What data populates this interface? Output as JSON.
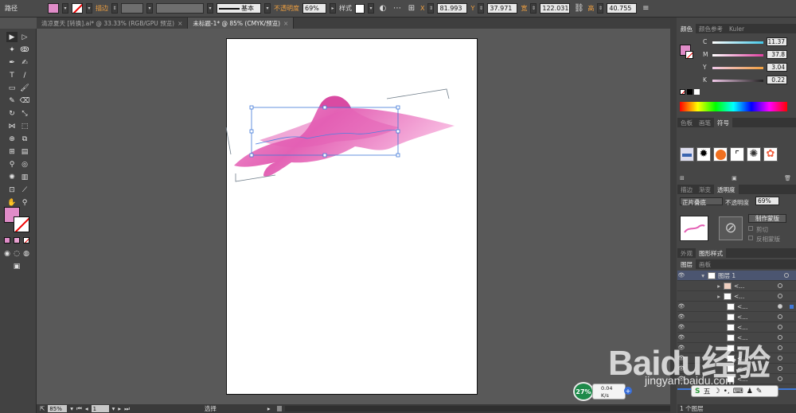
{
  "control_bar": {
    "object_type": "路径",
    "stroke_label": "描边",
    "stroke_profile": "基本",
    "opacity_label": "不透明度",
    "opacity_value": "69%",
    "style_label": "样式",
    "x_label": "X",
    "x_value": "81.993",
    "y_label": "Y",
    "y_value": "37.971",
    "w_label": "宽",
    "w_value": "122.031",
    "h_label": "高",
    "h_value": "40.755"
  },
  "tabs": [
    {
      "label": "清凉夏天 [转换].ai* @ 33.33% (RGB/GPU 预览)",
      "close": "×"
    },
    {
      "label": "未标题-1* @ 85% (CMYK/预览)",
      "close": "×"
    }
  ],
  "status_bar": {
    "zoom": "85%",
    "page": "1",
    "mode": "选择"
  },
  "panels": {
    "color_tabs": [
      "颜色",
      "颜色参考",
      "Kuler"
    ],
    "cmyk": [
      {
        "label": "C",
        "value": "11.37",
        "color": "#44c8e8"
      },
      {
        "label": "M",
        "value": "37.8",
        "color": "#e040a0"
      },
      {
        "label": "Y",
        "value": "3.04",
        "color": "#f0d000"
      },
      {
        "label": "K",
        "value": "0.22",
        "color": "#888888"
      }
    ],
    "symbol_tabs": [
      "色板",
      "画笔",
      "符号"
    ],
    "transparency_tabs": [
      "描边",
      "渐变",
      "透明度"
    ],
    "blend_mode": "正片叠底",
    "opacity_label": "不透明度",
    "opacity_value": "69%",
    "make_mask": "制作蒙版",
    "clip": "剪切",
    "invert_mask": "反相蒙版",
    "appearance_tabs": [
      "外观",
      "图形样式"
    ],
    "layers_tabs": [
      "图层",
      "画板"
    ],
    "layer_name": "图层 1",
    "sublayer_label": "<...",
    "layers_count": "1 个图层"
  },
  "overlay": {
    "speed_percent": "27%",
    "speed_up": "0.04",
    "speed_unit": "K/s",
    "ime_label": "五",
    "watermark": "Baidu经验",
    "watermark_url": "jingyan.baidu.com"
  },
  "colors": {
    "fill": "#e08cc8",
    "art_pink": "#e45fb4",
    "selection": "#2b64c8"
  }
}
